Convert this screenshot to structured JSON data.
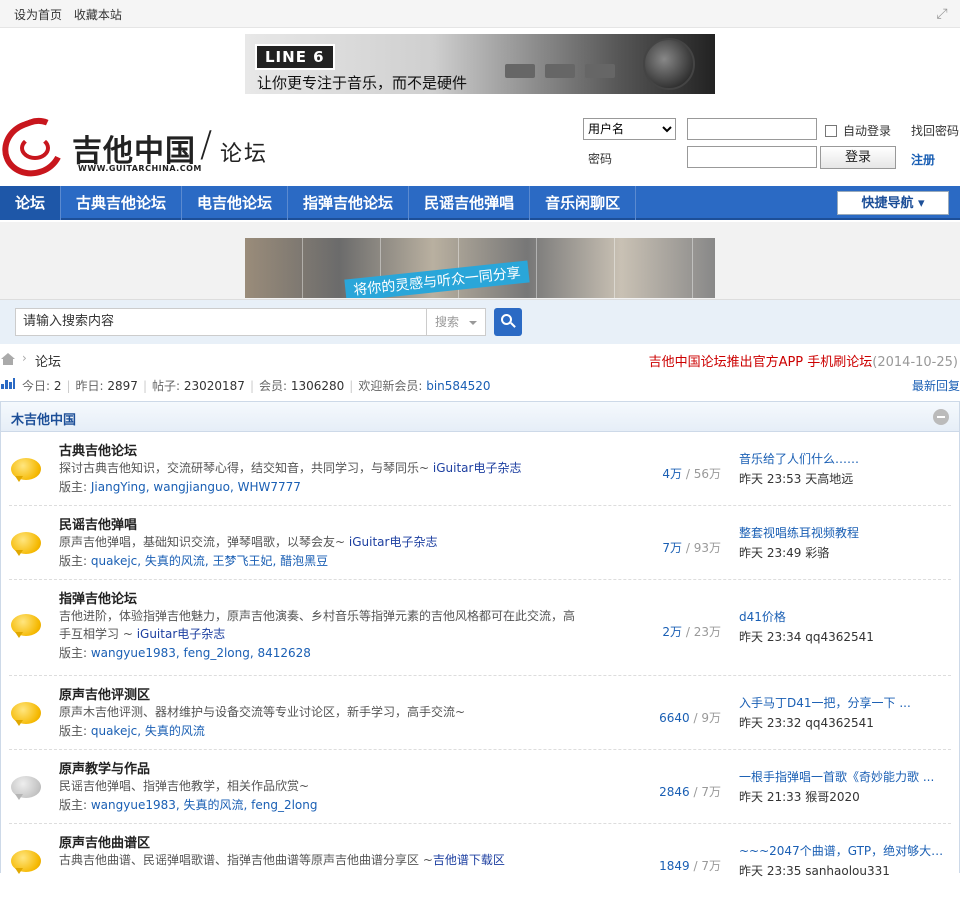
{
  "topbar": {
    "set_home": "设为首页",
    "bookmark": "收藏本站"
  },
  "banner_top": {
    "logo": "LINE 6",
    "tagline": "让你更专注于音乐，而不是硬件"
  },
  "brand": {
    "name": "吉他中国",
    "url": "WWW.GUITARCHINA.COM",
    "forum": "论坛"
  },
  "login": {
    "username_option": "用户名",
    "password_label": "密码",
    "auto_login": "自动登录",
    "login_button": "登录",
    "forgot": "找回密码",
    "register": "注册"
  },
  "nav": {
    "items": [
      "论坛",
      "古典吉他论坛",
      "电吉他论坛",
      "指弹吉他论坛",
      "民谣吉他弹唱",
      "音乐闲聊区"
    ],
    "quick": "快捷导航"
  },
  "banner_mid": {
    "slogan": "将你的灵感与听众一同分享"
  },
  "search": {
    "placeholder": "请输入搜索内容",
    "type": "搜索"
  },
  "breadcrumb": {
    "current": "论坛",
    "notice": "吉他中国论坛推出官方APP 手机刷论坛",
    "notice_date": "(2014-10-25)"
  },
  "stats": {
    "today_label": "今日: ",
    "today": "2",
    "yesterday_label": "昨日: ",
    "yesterday": "2897",
    "posts_label": "帖子: ",
    "posts": "23020187",
    "members_label": "会员: ",
    "members": "1306280",
    "welcome_label": "欢迎新会员: ",
    "new_member": "bin584520",
    "latest_reply": "最新回复"
  },
  "section": {
    "title": "木吉他中国"
  },
  "forums": [
    {
      "name": "古典吉他论坛",
      "desc": "探讨古典吉他知识，交流研琴心得，结交知音，共同学习，与琴同乐~ ",
      "mag": "iGuitar电子杂志",
      "mods_label": "版主: ",
      "mods": "JiangYing, wangjianguo, WHW7777",
      "threads": "4万",
      "posts": " / 56万",
      "last_title": "音乐给了人们什么……",
      "last_meta": "昨天 23:53 天高地远"
    },
    {
      "name": "民谣吉他弹唱",
      "desc": "原声吉他弹唱，基础知识交流，弹琴唱歌，以琴会友~ ",
      "mag": "iGuitar电子杂志",
      "mods_label": "版主: ",
      "mods": "quakejc, 失真的风流, 王梦飞王妃, 醋泡黑豆",
      "threads": "7万",
      "posts": " / 93万",
      "last_title": "整套视唱练耳视频教程",
      "last_meta": "昨天 23:49 彩骆"
    },
    {
      "name": "指弹吉他论坛",
      "desc": "吉他进阶，体验指弹吉他魅力，原声吉他演奏、乡村音乐等指弹元素的吉他风格都可在此交流，高手互相学习 ~ ",
      "mag": "iGuitar电子杂志",
      "mods_label": "版主: ",
      "mods": "wangyue1983, feng_2long, 8412628",
      "threads": "2万",
      "posts": " / 23万",
      "last_title": "d41价格",
      "last_meta": "昨天 23:34 qq4362541"
    },
    {
      "name": "原声吉他评测区",
      "desc": "原声木吉他评测、器材维护与设备交流等专业讨论区，新手学习，高手交流~",
      "mag": "",
      "mods_label": "版主: ",
      "mods": "quakejc, 失真的风流",
      "threads": "6640",
      "posts": " / 9万",
      "last_title": "入手马丁D41一把，分享一下 ...",
      "last_meta": "昨天 23:32 qq4362541"
    },
    {
      "name": "原声教学与作品",
      "desc": "民谣吉他弹唱、指弹吉他教学，相关作品欣赏~",
      "mag": "",
      "mods_label": "版主: ",
      "mods": "wangyue1983, 失真的风流, feng_2long",
      "threads": "2846",
      "posts": " / 7万",
      "last_title": "一根手指弹唱一首歌《奇妙能力歌 ...",
      "last_meta": "昨天 21:33 猴哥2020"
    },
    {
      "name": "原声吉他曲谱区",
      "desc": "古典吉他曲谱、民谣弹唱歌谱、指弹吉他曲谱等原声吉他曲谱分享区 ~",
      "mag": "吉他谱下载区",
      "mods_label": "",
      "mods": "",
      "threads": "1849",
      "posts": " / 7万",
      "last_title": "~~~2047个曲谱，GTP，绝对够大家 ...",
      "last_meta": "昨天 23:35 sanhaolou331"
    }
  ]
}
